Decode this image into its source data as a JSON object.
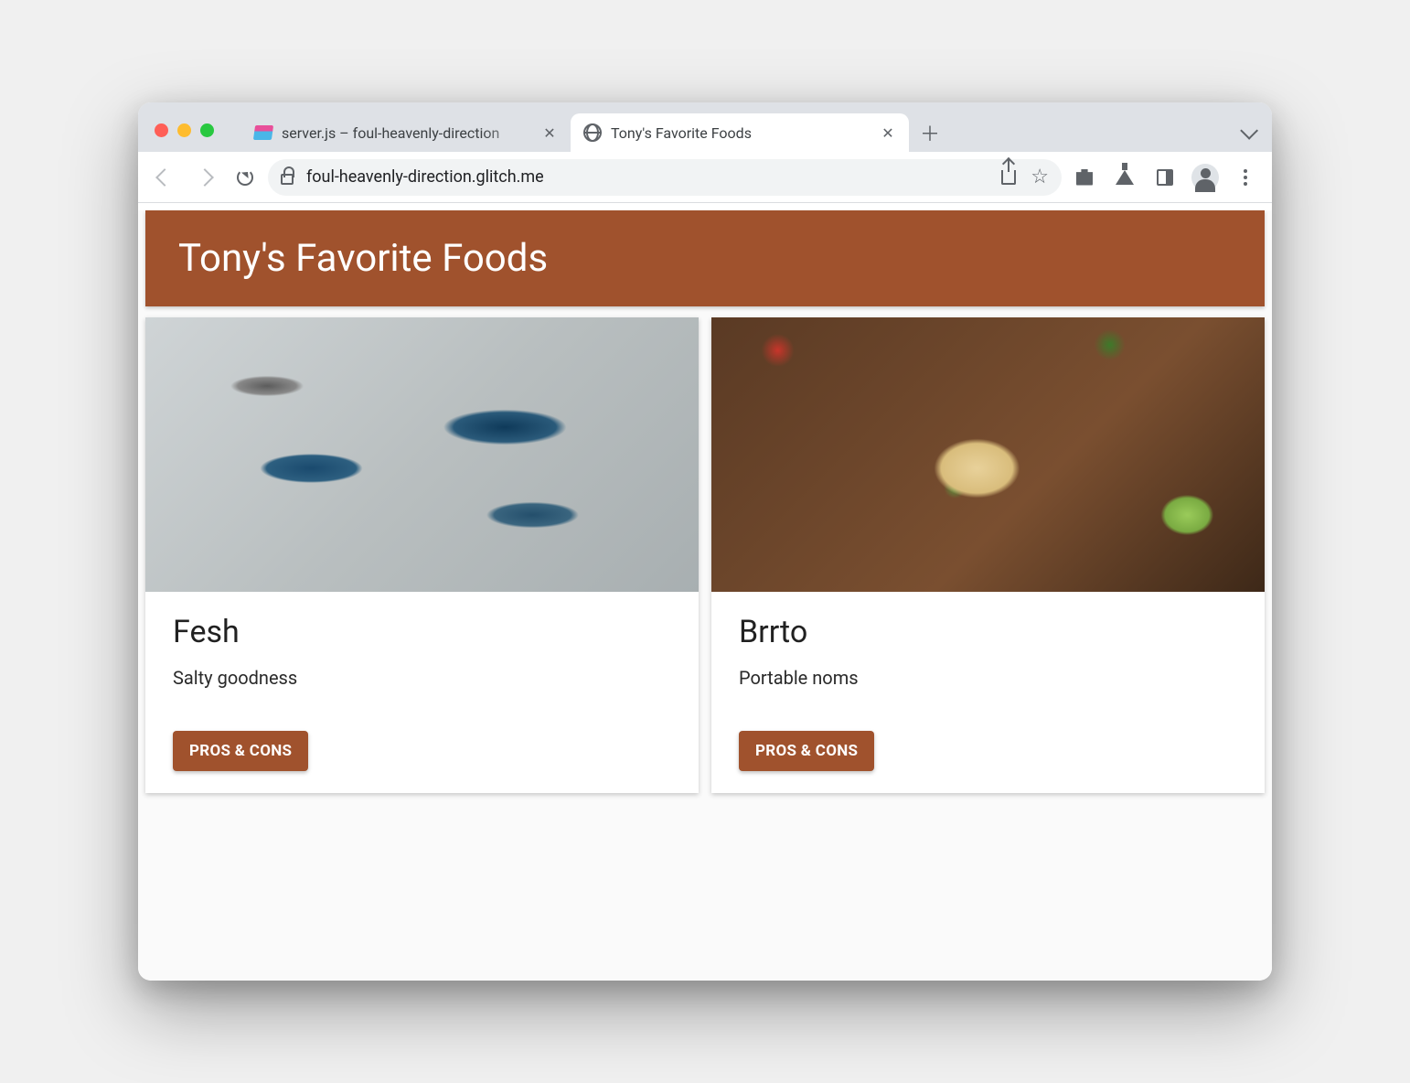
{
  "browser": {
    "tabs": [
      {
        "title": "server.js – foul-heavenly-direction",
        "favicon": "glitch-icon",
        "active": false
      },
      {
        "title": "Tony's Favorite Foods",
        "favicon": "globe-icon",
        "active": true
      }
    ],
    "url": "foul-heavenly-direction.glitch.me"
  },
  "page": {
    "headerTitle": "Tony's Favorite Foods",
    "cards": [
      {
        "title": "Fesh",
        "description": "Salty goodness",
        "button": "PROS & CONS",
        "image": "fish"
      },
      {
        "title": "Brrto",
        "description": "Portable noms",
        "button": "PROS & CONS",
        "image": "burrito"
      }
    ]
  },
  "colors": {
    "accent": "#A0522D"
  }
}
